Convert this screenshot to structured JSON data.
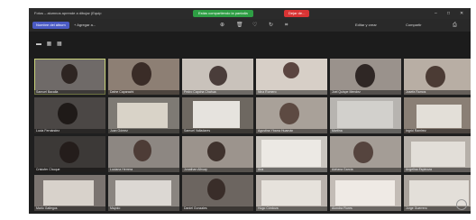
{
  "window": {
    "title": "Fotos – alumnos aprende a dibujar (Equip",
    "share_status": "Estás compartiendo la pantalla",
    "stop_label": "Dejar de..."
  },
  "toolbar": {
    "primary_button": "Nombre del álbum",
    "secondary_button": "+ Agregar a...",
    "edit_label": "Editar y crear",
    "share_label": "Compartir"
  },
  "participants": [
    {
      "name": "Samuel Bacalla"
    },
    {
      "name": "Dafne Caparachi"
    },
    {
      "name": "Pedro Capcha Chahua"
    },
    {
      "name": "Nina Romero"
    },
    {
      "name": "Joel Quispe Mendez"
    },
    {
      "name": "Josefa Ramos"
    },
    {
      "name": "Lucia Fernández"
    },
    {
      "name": "Juan Gómez"
    },
    {
      "name": "Samuel Valladares"
    },
    {
      "name": "Agustina Ybarra Huamán"
    },
    {
      "name": "Martina"
    },
    {
      "name": "Ingrid Ramirez"
    },
    {
      "name": "Cristofer Choque"
    },
    {
      "name": "Luciana Herrera"
    },
    {
      "name": "Jonathan Alhuay"
    },
    {
      "name": "Ana"
    },
    {
      "name": "Adriana García"
    },
    {
      "name": "Angelina Espinoza"
    },
    {
      "name": "Mario Gallegos"
    },
    {
      "name": "Mayolo"
    },
    {
      "name": "Daniel Gonzales"
    },
    {
      "name": "Hugo Córdova"
    },
    {
      "name": "Alondra Flores"
    },
    {
      "name": "Jorge Guerrero"
    }
  ]
}
